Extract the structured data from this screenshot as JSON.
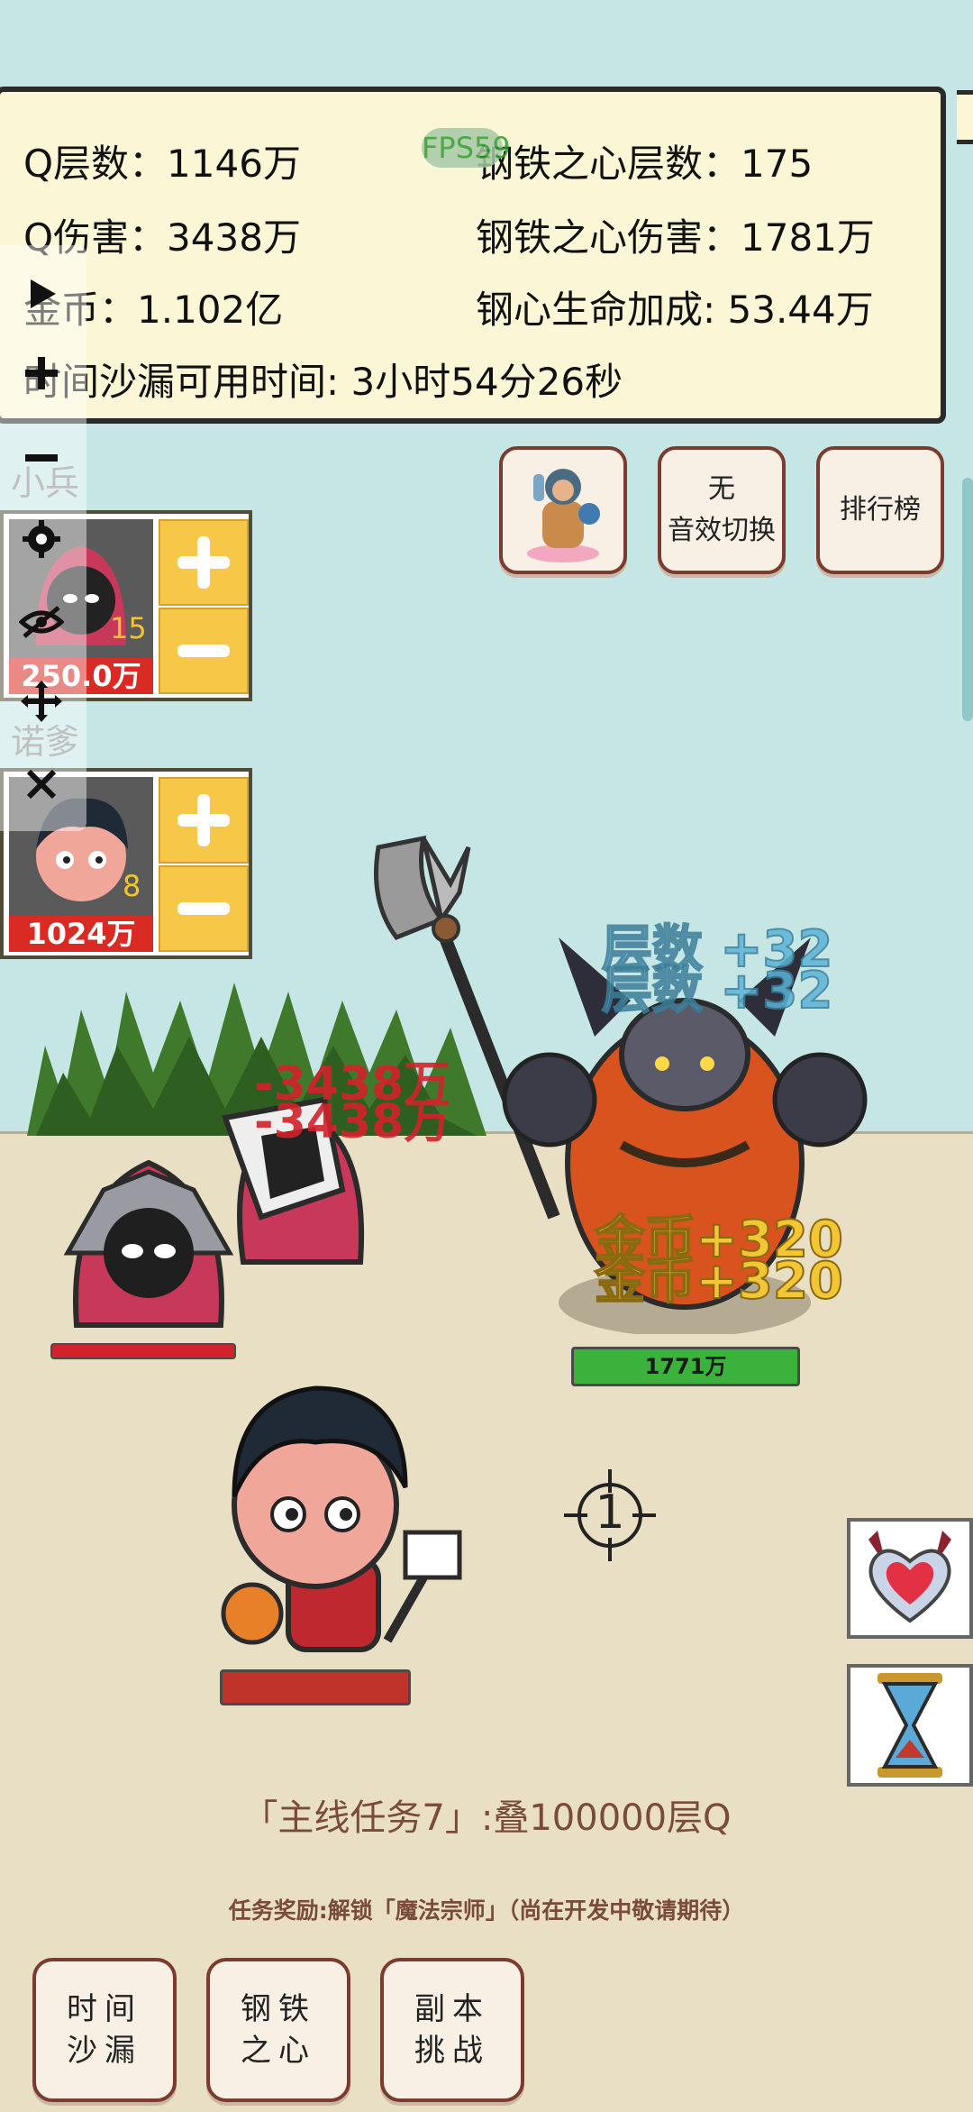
{
  "stats": {
    "q_layers": "Q层数：1146万",
    "q_damage": "Q伤害：3438万",
    "gold": "金币：1.102亿",
    "hourglass_time": "时间沙漏可用时间: 3小时54分26秒",
    "steel_layers": "钢铁之心层数：175",
    "steel_damage": "钢铁之心伤害：1781万",
    "steel_hp_bonus": "钢心生命加成: 53.44万",
    "fps": "FPS59"
  },
  "top_buttons": {
    "sound_line1": "无",
    "sound_line2": "音效切换",
    "leaderboard": "排行榜"
  },
  "units": [
    {
      "label": "小兵",
      "level": "15",
      "cost": "250.0万"
    },
    {
      "label": "诺爹",
      "level": "8",
      "cost": "1024万"
    }
  ],
  "battle": {
    "damage_text": "-3438万",
    "layer_gain": "层数 +32",
    "gold_gain": "金币+320",
    "boss_hp": "1771万",
    "crosshair_number": "1"
  },
  "quest": {
    "title": "「主线任务7」:叠100000层Q",
    "reward": "任务奖励:解锁「魔法宗师」（尚在开发中敬请期待）"
  },
  "bottom_buttons": [
    {
      "line1": "时间",
      "line2": "沙漏"
    },
    {
      "line1": "钢铁",
      "line2": "之心"
    },
    {
      "line1": "副本",
      "line2": "挑战"
    }
  ],
  "colors": {
    "sky": "#c6e6e6",
    "ground": "#e8dfc4",
    "panel": "#fbf7d6",
    "damage_red": "#d2232a",
    "layer_blue": "#5ab4d8",
    "gold_yellow": "#f3c634",
    "hp_green": "#3bb23b",
    "button_border": "#7b3b2f"
  }
}
